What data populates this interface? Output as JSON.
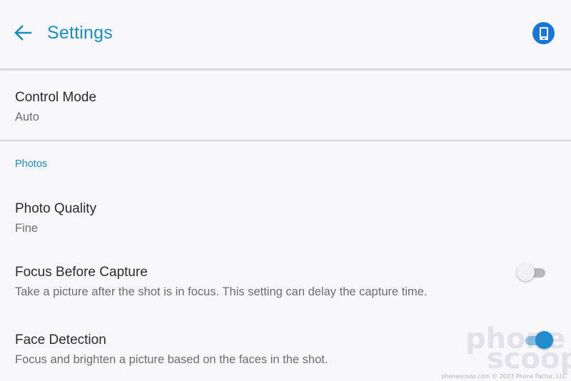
{
  "header": {
    "title": "Settings",
    "back_icon": "arrow-left-icon",
    "device_icon": "phone-device-icon",
    "accent_color": "#1a8fbf"
  },
  "items": {
    "control_mode": {
      "title": "Control Mode",
      "value": "Auto"
    },
    "photos_section": "Photos",
    "photo_quality": {
      "title": "Photo Quality",
      "value": "Fine"
    },
    "focus_before_capture": {
      "title": "Focus Before Capture",
      "description": "Take a picture after the shot is in focus. This setting can delay the capture time.",
      "enabled": false
    },
    "face_detection": {
      "title": "Face Detection",
      "description": "Focus and brighten a picture based on the faces in the shot.",
      "enabled": true
    }
  },
  "watermark": {
    "line1": "phone",
    "line2": "scoop",
    "credit": "phonescoop.com  © 2023 Phone Factor, LLC"
  }
}
